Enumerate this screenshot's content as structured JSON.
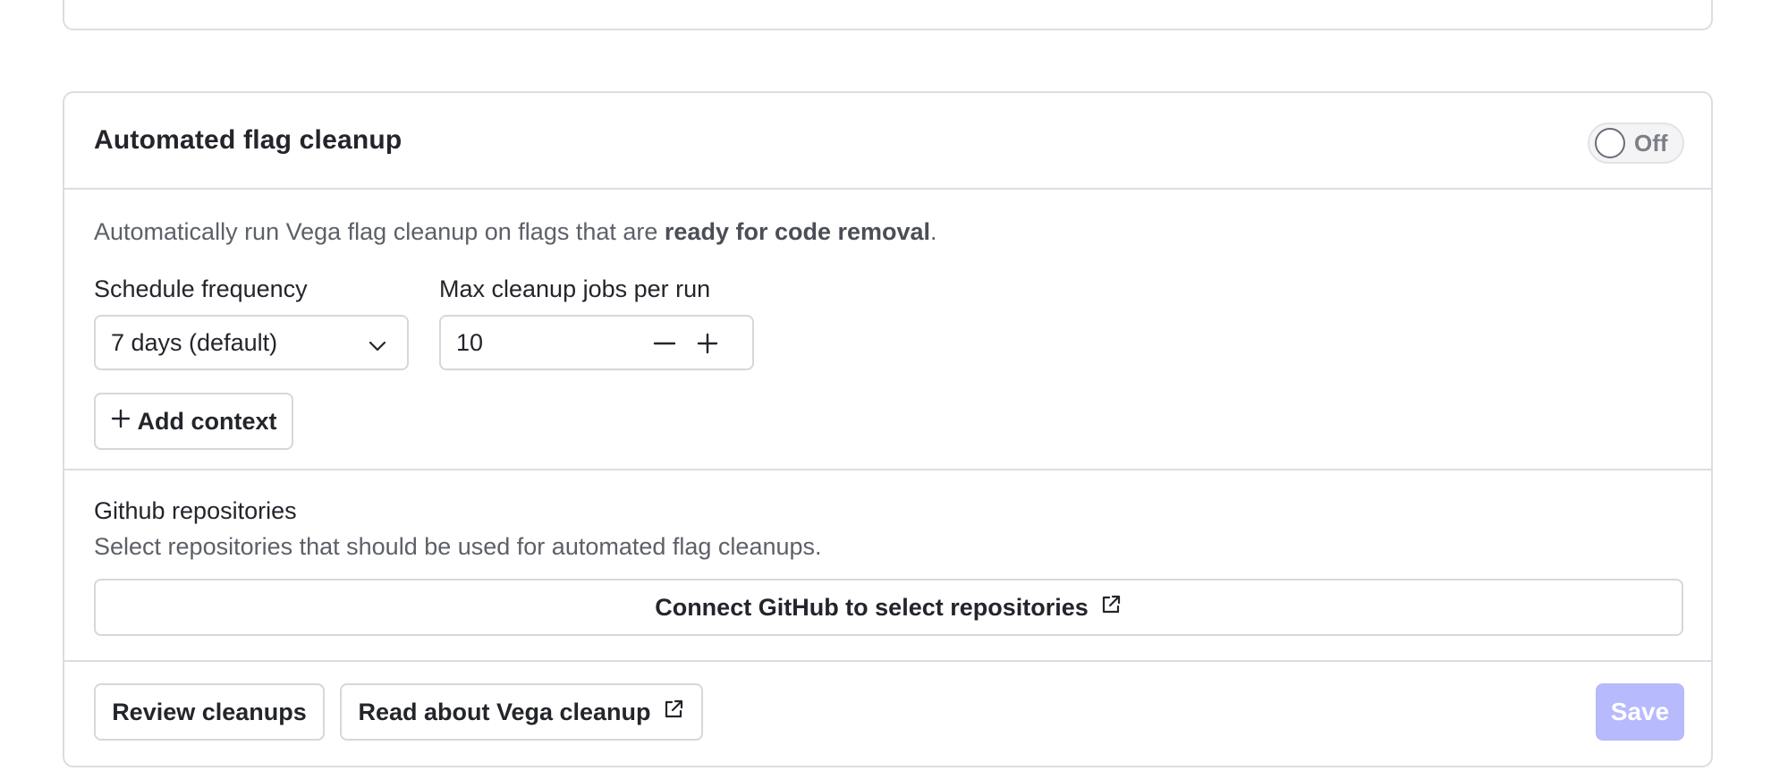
{
  "card": {
    "title": "Automated flag cleanup",
    "toggle_label": "Off",
    "toggle_on": false
  },
  "config": {
    "description_prefix": "Automatically run Vega flag cleanup on flags that are ",
    "description_bold": "ready for code removal",
    "description_suffix": ".",
    "schedule_label": "Schedule frequency",
    "schedule_value": "7 days (default)",
    "max_jobs_label": "Max cleanup jobs per run",
    "max_jobs_value": "10",
    "add_context_label": "Add context"
  },
  "repos": {
    "title": "Github repositories",
    "description": "Select repositories that should be used for automated flag cleanups.",
    "connect_label": "Connect GitHub to select repositories"
  },
  "footer": {
    "review_label": "Review cleanups",
    "read_label": "Read about Vega cleanup",
    "save_label": "Save"
  },
  "colors": {
    "border": "#dcdde3",
    "text": "#23252b",
    "muted": "#5d6068",
    "save_disabled": "#b7bafc"
  },
  "icons": {
    "toggle": "toggle-knob",
    "select": "chevron-down-icon",
    "minus": "minus-icon",
    "plus": "plus-icon",
    "external": "external-link-icon"
  }
}
